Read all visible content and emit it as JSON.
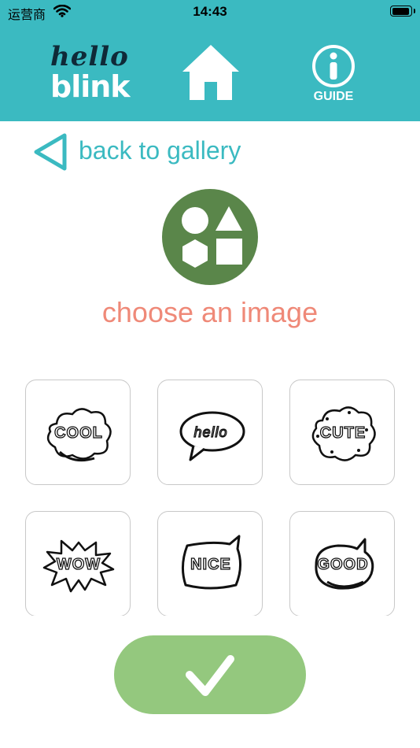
{
  "status_bar": {
    "carrier": "运营商",
    "time": "14:43",
    "battery_level": 0.95
  },
  "header": {
    "logo_line1": "hello",
    "logo_line2": "blink",
    "home_icon": "home-icon",
    "guide_icon": "info-icon",
    "guide_label": "GUIDE",
    "accent_color": "#3bbac1"
  },
  "nav": {
    "back_label": "back to gallery"
  },
  "main": {
    "title": "choose an image",
    "title_color": "#ef8978",
    "icon": "shapes-icon",
    "icon_color": "#5a864a"
  },
  "gallery": {
    "tiles": [
      {
        "label": "COOL",
        "icon": "cool-cloud-sticker"
      },
      {
        "label": "hello",
        "icon": "hello-speech-bubble-sticker"
      },
      {
        "label": "CUTE",
        "icon": "cute-cloud-sticker"
      },
      {
        "label": "WOW",
        "icon": "wow-burst-sticker"
      },
      {
        "label": "NICE",
        "icon": "nice-speech-bubble-sticker"
      },
      {
        "label": "GOOD",
        "icon": "good-speech-bubble-sticker"
      }
    ]
  },
  "confirm": {
    "icon": "checkmark-icon",
    "color": "#94c87e"
  }
}
